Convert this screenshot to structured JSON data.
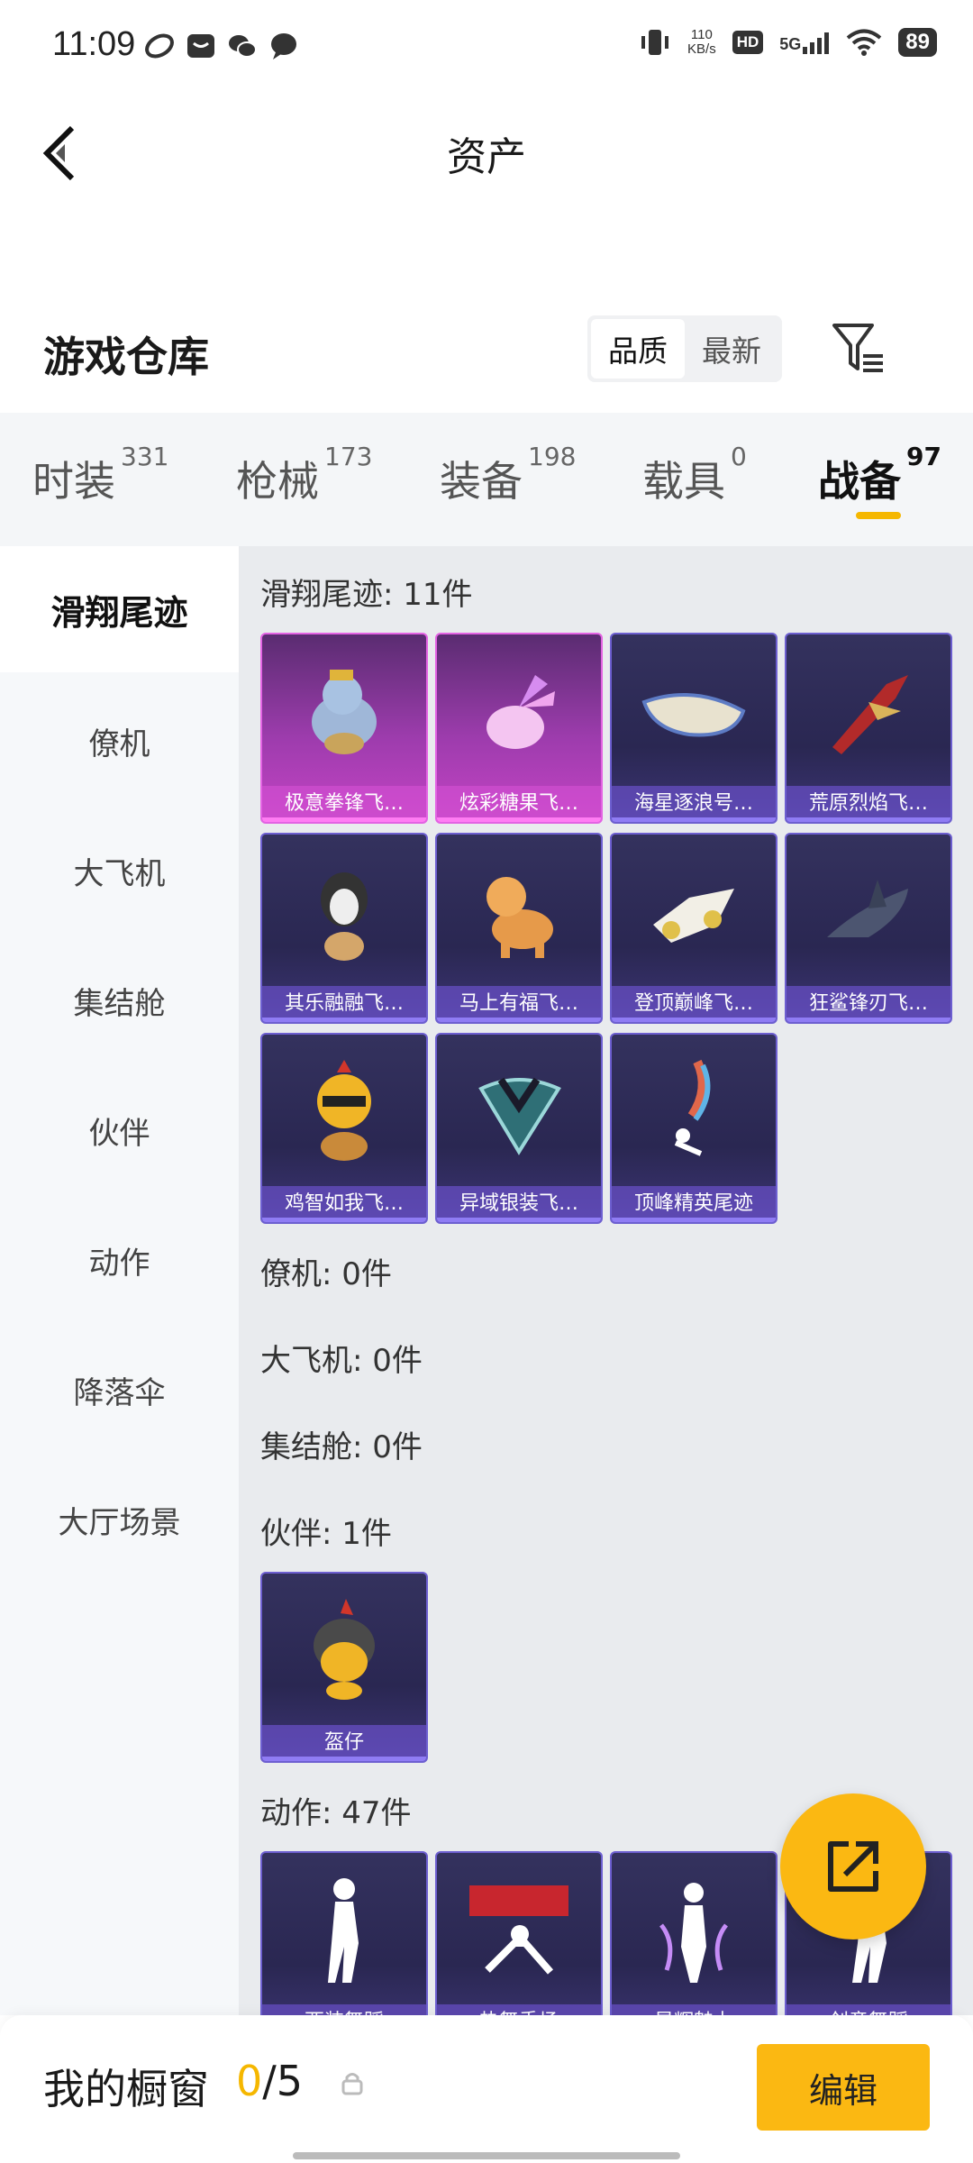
{
  "status_bar": {
    "time": "11:09",
    "net_speed_value": "110",
    "net_speed_unit": "KB/s",
    "hd": "HD",
    "network": "5G",
    "battery": "89",
    "icons": [
      "app-icon",
      "mail-icon",
      "wechat-icon",
      "chat-icon",
      "vibrate-icon",
      "signal-icon",
      "wifi-icon"
    ]
  },
  "header": {
    "title": "资产",
    "back_icon": "chevron-left-icon"
  },
  "warehouse": {
    "title": "游戏仓库",
    "sort_options": [
      "品质",
      "最新"
    ],
    "active_sort": "品质",
    "filter_icon": "filter-icon"
  },
  "tabs": [
    {
      "label": "时装",
      "count": "331"
    },
    {
      "label": "枪械",
      "count": "173"
    },
    {
      "label": "装备",
      "count": "198"
    },
    {
      "label": "载具",
      "count": "0"
    },
    {
      "label": "战备",
      "count": "97"
    }
  ],
  "active_tab": "战备",
  "sidebar": {
    "items": [
      "滑翔尾迹",
      "僚机",
      "大飞机",
      "集结舱",
      "伙伴",
      "动作",
      "降落伞",
      "大厅场景"
    ],
    "active": "滑翔尾迹"
  },
  "sections": {
    "glide": {
      "title": "滑翔尾迹: 11件",
      "items": [
        {
          "label": "极意拳锋飞…",
          "rarity": "pink"
        },
        {
          "label": "炫彩糖果飞…",
          "rarity": "pink"
        },
        {
          "label": "海星逐浪号…",
          "rarity": "purple"
        },
        {
          "label": "荒原烈焰飞…",
          "rarity": "purple"
        },
        {
          "label": "其乐融融飞…",
          "rarity": "purple"
        },
        {
          "label": "马上有福飞…",
          "rarity": "purple"
        },
        {
          "label": "登顶巅峰飞…",
          "rarity": "purple"
        },
        {
          "label": "狂鲨锋刃飞…",
          "rarity": "purple"
        },
        {
          "label": "鸡智如我飞…",
          "rarity": "purple"
        },
        {
          "label": "异域银装飞…",
          "rarity": "purple"
        },
        {
          "label": "顶峰精英尾迹",
          "rarity": "purple"
        }
      ]
    },
    "wingman": {
      "title": "僚机: 0件"
    },
    "plane": {
      "title": "大飞机: 0件"
    },
    "pod": {
      "title": "集结舱: 0件"
    },
    "partner": {
      "title": "伙伴: 1件",
      "items": [
        {
          "label": "盔仔",
          "rarity": "purple"
        }
      ]
    },
    "emote": {
      "title": "动作: 47件",
      "items": [
        {
          "label": "西装舞蹈",
          "rarity": "purple"
        },
        {
          "label": "热舞秀场",
          "rarity": "purple"
        },
        {
          "label": "星辉魅力",
          "rarity": "purple"
        },
        {
          "label": "创意舞蹈",
          "rarity": "purple"
        }
      ]
    }
  },
  "share_icon": "share-external-icon",
  "bottom": {
    "label": "我的橱窗",
    "count": "0",
    "total": "/5",
    "lock_icon": "lock-icon",
    "edit_label": "编辑"
  }
}
